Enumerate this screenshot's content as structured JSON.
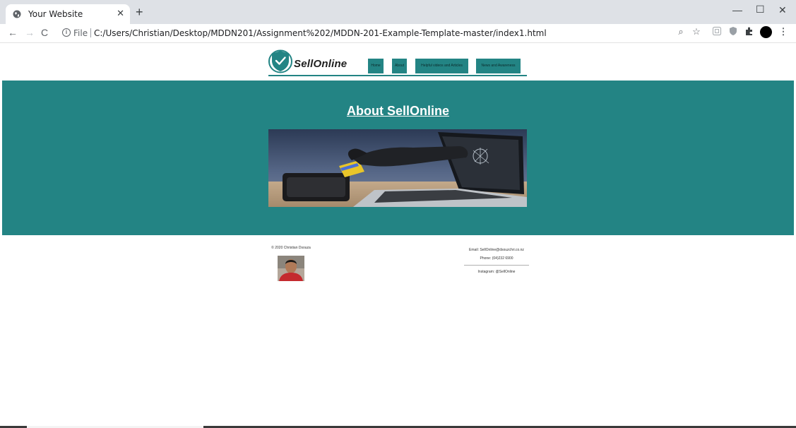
{
  "browser": {
    "tab_title": "Your Website",
    "scheme_label": "File",
    "url": "C:/Users/Christian/Desktop/MDDN201/Assignment%202/MDDN-201-Example-Template-master/index1.html"
  },
  "site": {
    "logo_text": "SellOnline",
    "nav": [
      "Home",
      "About",
      "Helpful videos and Articles",
      "News and Awareness"
    ],
    "hero_title": "About SellOnline",
    "footer": {
      "copyright": "© 2020 Christian Dsouza",
      "email": "Email: SellOnline@dsouzchri.co.nz",
      "phone": "Phone: (04)232 6900",
      "instagram": "Instagram: @SellOnline"
    }
  },
  "colors": {
    "accent": "#238484",
    "tabbar": "#dee1e6"
  },
  "icons": {
    "tab_favicon": "globe-icon",
    "back": "arrow-left-icon",
    "forward": "arrow-right-icon",
    "reload": "reload-icon",
    "info": "info-icon",
    "zoom": "zoom-icon",
    "bookmark": "star-icon",
    "extensions": "puzzle-icon",
    "menu": "more-vertical-icon"
  }
}
